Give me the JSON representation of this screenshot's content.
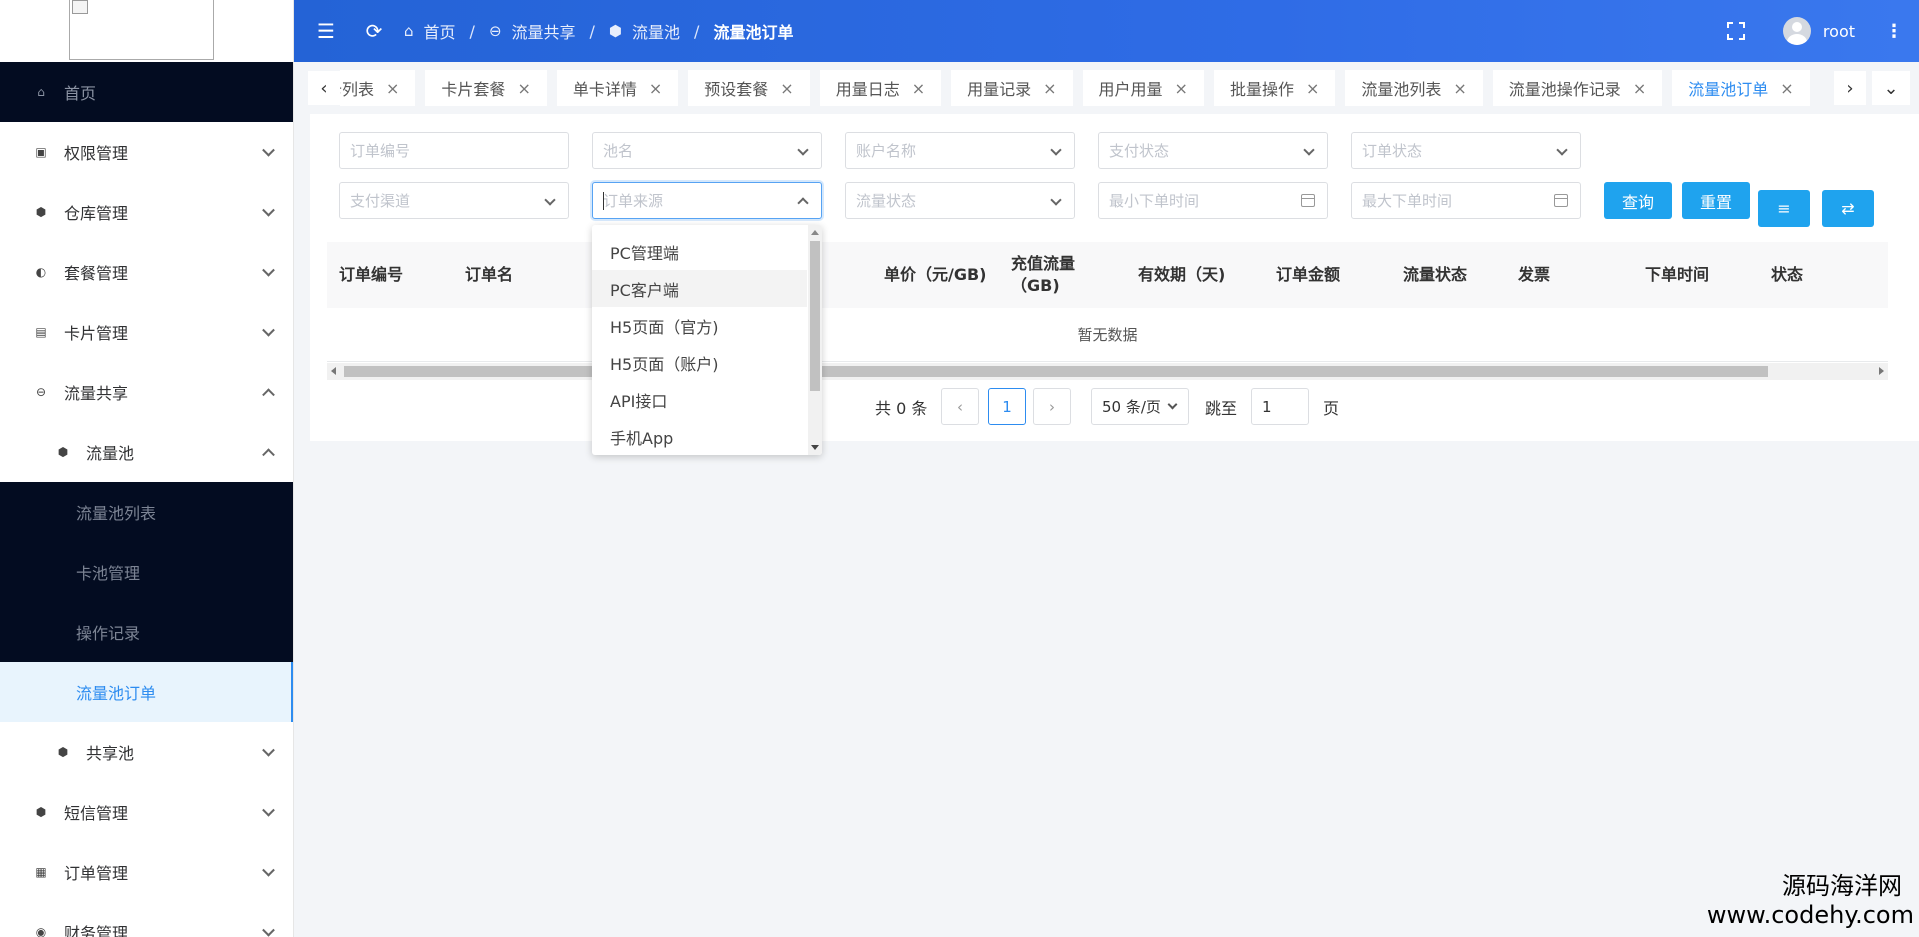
{
  "header": {
    "breadcrumb": [
      "首页",
      "流量共享",
      "流量池",
      "流量池订单"
    ],
    "username": "root"
  },
  "sidebar": {
    "items": [
      {
        "label": "首页",
        "icon": "home-icon"
      },
      {
        "label": "权限管理",
        "icon": "lock-icon"
      },
      {
        "label": "仓库管理",
        "icon": "cube-icon"
      },
      {
        "label": "套餐管理",
        "icon": "package-icon"
      },
      {
        "label": "卡片管理",
        "icon": "card-icon"
      },
      {
        "label": "流量共享",
        "icon": "share-icon"
      },
      {
        "label": "流量池",
        "icon": "cube-icon"
      },
      {
        "label": "流量池列表"
      },
      {
        "label": "卡池管理"
      },
      {
        "label": "操作记录"
      },
      {
        "label": "流量池订单"
      },
      {
        "label": "共享池",
        "icon": "cube-icon"
      },
      {
        "label": "短信管理",
        "icon": "cube-icon"
      },
      {
        "label": "订单管理",
        "icon": "order-icon"
      },
      {
        "label": "财务管理",
        "icon": "finance-icon"
      }
    ]
  },
  "tabs": [
    {
      "label": "卡列表"
    },
    {
      "label": "卡片套餐"
    },
    {
      "label": "单卡详情"
    },
    {
      "label": "预设套餐"
    },
    {
      "label": "用量日志"
    },
    {
      "label": "用量记录"
    },
    {
      "label": "用户用量"
    },
    {
      "label": "批量操作"
    },
    {
      "label": "流量池列表"
    },
    {
      "label": "流量池操作记录"
    },
    {
      "label": "流量池订单"
    }
  ],
  "filters": {
    "order_no": "订单编号",
    "pool_name": "池名",
    "account_name": "账户名称",
    "pay_status": "支付状态",
    "order_status": "订单状态",
    "pay_channel": "支付渠道",
    "order_source": "订单来源",
    "flow_status": "流量状态",
    "min_time": "最小下单时间",
    "max_time": "最大下单时间"
  },
  "buttons": {
    "query": "查询",
    "reset": "重置"
  },
  "table": {
    "columns": [
      "订单编号",
      "订单名",
      "单价（元/GB)",
      "充值流量（GB)",
      "有效期（天)",
      "订单金额",
      "流量状态",
      "发票",
      "下单时间",
      "状态"
    ],
    "empty_text": "暂无数据"
  },
  "pagination": {
    "total_text": "共 0 条",
    "current_page": "1",
    "page_size": "50 条/页",
    "jump_label": "跳至",
    "jump_value": "1",
    "page_unit": "页"
  },
  "dropdown": {
    "options": [
      "PC管理端",
      "PC客户端",
      "H5页面（官方)",
      "H5页面（账户)",
      "API接口",
      "手机App"
    ],
    "hovered_index": 1
  },
  "watermark": {
    "line1": "源码海洋网",
    "line2": "www.codehy.com"
  },
  "colors": {
    "accent": "#2d8cf0",
    "button": "#1fa3ee",
    "header": "#2f6ce6",
    "sidebar_dark": "#030c21"
  }
}
